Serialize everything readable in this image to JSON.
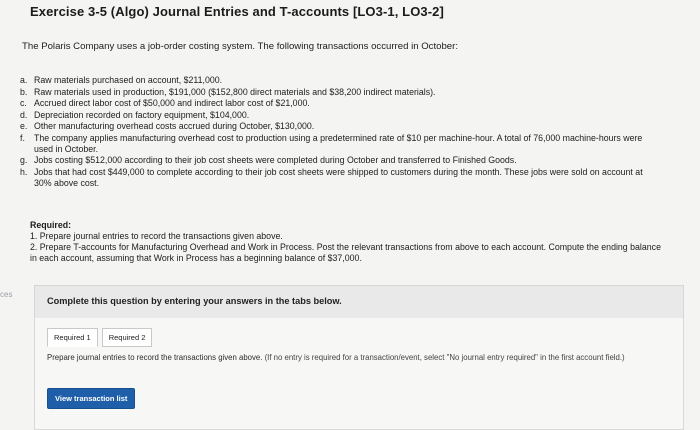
{
  "title": "Exercise 3-5 (Algo) Journal Entries and T-accounts [LO3-1, LO3-2]",
  "intro": "The Polaris Company uses a job-order costing system. The following transactions occurred in October:",
  "transactions": [
    {
      "letter": "a.",
      "text": "Raw materials purchased on account, $211,000."
    },
    {
      "letter": "b.",
      "text": "Raw materials used in production, $191,000 ($152,800 direct materials and $38,200 indirect materials)."
    },
    {
      "letter": "c.",
      "text": "Accrued direct labor cost of $50,000 and indirect labor cost of $21,000."
    },
    {
      "letter": "d.",
      "text": "Depreciation recorded on factory equipment, $104,000."
    },
    {
      "letter": "e.",
      "text": "Other manufacturing overhead costs accrued during October, $130,000."
    },
    {
      "letter": "f.",
      "text": "The company applies manufacturing overhead cost to production using a predetermined rate of $10 per machine-hour. A total of 76,000 machine-hours were used in October."
    },
    {
      "letter": "g.",
      "text": "Jobs costing $512,000 according to their job cost sheets were completed during October and transferred to Finished Goods."
    },
    {
      "letter": "h.",
      "text": "Jobs that had cost $449,000 to complete according to their job cost sheets were shipped to customers during the month. These jobs were sold on account at 30% above cost."
    }
  ],
  "required": {
    "heading": "Required:",
    "item1": "1. Prepare journal entries to record the transactions given above.",
    "item2": "2. Prepare T-accounts for Manufacturing Overhead and Work in Process. Post the relevant transactions from above to each account. Compute the ending balance in each account, assuming that Work in Process has a beginning balance of $37,000."
  },
  "side_label": "ces",
  "banner": "Complete this question by entering your answers in the tabs below.",
  "tabs": {
    "tab1": "Required 1",
    "tab2": "Required 2"
  },
  "instruction": {
    "main": "Prepare journal entries to record the transactions given above.",
    "note": "(If no entry is required for a transaction/event, select \"No journal entry required\" in the first account field.)"
  },
  "view_button": "View transaction list"
}
